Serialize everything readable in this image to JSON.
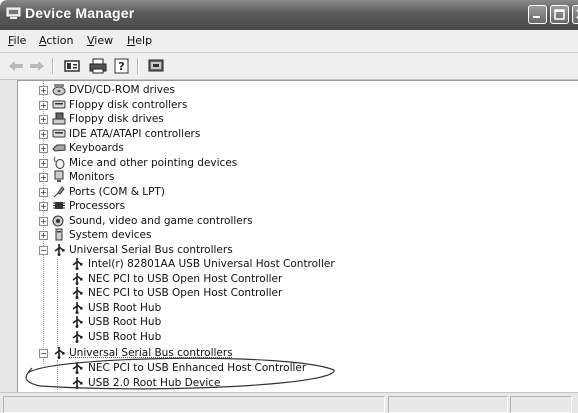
{
  "window": {
    "title": "Device Manager",
    "title_icon": "computer-icon"
  },
  "menu": [
    {
      "id": "file",
      "label": "File"
    },
    {
      "id": "action",
      "label": "Action"
    },
    {
      "id": "view",
      "label": "View"
    },
    {
      "id": "help",
      "label": "Help"
    }
  ],
  "toolbar": {
    "buttons": [
      {
        "id": "back",
        "icon": "back-arrow-icon"
      },
      {
        "id": "forward",
        "icon": "forward-arrow-icon"
      },
      {
        "id": "properties",
        "icon": "properties-icon"
      },
      {
        "id": "print",
        "icon": "print-icon"
      },
      {
        "id": "help",
        "icon": "help-icon"
      },
      {
        "id": "scan",
        "icon": "scan-hardware-icon"
      }
    ]
  },
  "tree": {
    "items": [
      {
        "label": "DVD/CD-ROM drives",
        "icon": "dvd-drive-icon",
        "state": "collapsed"
      },
      {
        "label": "Floppy disk controllers",
        "icon": "disk-controller-icon",
        "state": "collapsed"
      },
      {
        "label": "Floppy disk drives",
        "icon": "floppy-drive-icon",
        "state": "collapsed"
      },
      {
        "label": "IDE ATA/ATAPI controllers",
        "icon": "ide-controller-icon",
        "state": "collapsed"
      },
      {
        "label": "Keyboards",
        "icon": "keyboard-icon",
        "state": "collapsed"
      },
      {
        "label": "Mice and other pointing devices",
        "icon": "mouse-icon",
        "state": "collapsed"
      },
      {
        "label": "Monitors",
        "icon": "monitor-icon",
        "state": "collapsed"
      },
      {
        "label": "Ports (COM & LPT)",
        "icon": "port-icon",
        "state": "collapsed"
      },
      {
        "label": "Processors",
        "icon": "processor-icon",
        "state": "collapsed"
      },
      {
        "label": "Sound, video and game controllers",
        "icon": "sound-icon",
        "state": "collapsed"
      },
      {
        "label": "System devices",
        "icon": "system-device-icon",
        "state": "collapsed"
      },
      {
        "label": "Universal Serial Bus controllers",
        "icon": "usb-icon",
        "state": "expanded",
        "children": [
          "Intel(r) 82801AA USB Universal Host Controller",
          "NEC PCI to USB Open Host Controller",
          "NEC PCI to USB Open Host Controller",
          "USB Root Hub",
          "USB Root Hub",
          "USB Root Hub"
        ]
      },
      {
        "label": "Universal Serial Bus controllers",
        "icon": "usb-icon",
        "state": "expanded",
        "children": [
          "NEC PCI to USB Enhanced Host Controller",
          "USB 2.0 Root Hub Device"
        ]
      }
    ]
  },
  "annotation": {
    "shape": "ellipse",
    "highlights": "second Universal Serial Bus controllers group"
  }
}
